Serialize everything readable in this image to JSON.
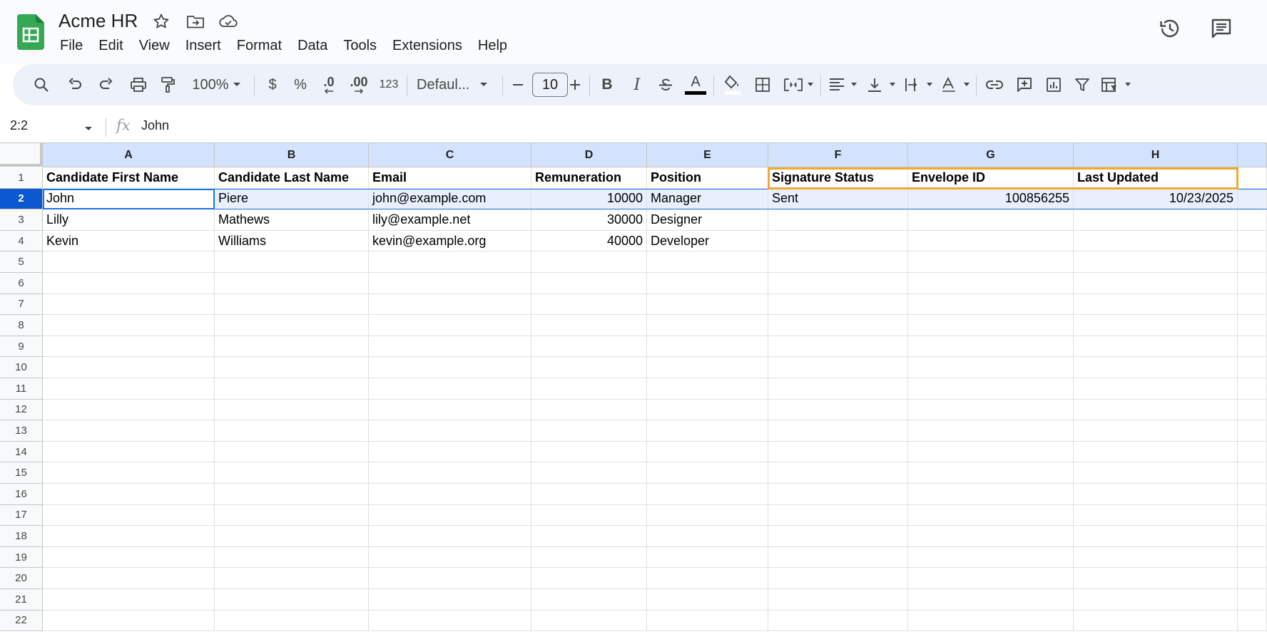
{
  "app": {
    "doc_title": "Acme HR",
    "menu": [
      "File",
      "Edit",
      "View",
      "Insert",
      "Format",
      "Data",
      "Tools",
      "Extensions",
      "Help"
    ]
  },
  "toolbar": {
    "zoom": "100%",
    "currency_label": "$",
    "percent_label": "%",
    "decrease_decimal_label": ".0",
    "increase_decimal_label": ".00",
    "number_format_label": "123",
    "font_family": "Defaul...",
    "font_size": "10",
    "bold_label": "B",
    "italic_label": "I",
    "text_color_label": "A",
    "text_color": "#000000"
  },
  "formula_bar": {
    "name_box": "2:2",
    "fx_label": "fx",
    "value": "John"
  },
  "sheet": {
    "columns": [
      "A",
      "B",
      "C",
      "D",
      "E",
      "F",
      "G",
      "H"
    ],
    "row_numbers": [
      "1",
      "2",
      "3",
      "4",
      "5",
      "6",
      "7",
      "8",
      "9",
      "10",
      "11",
      "12",
      "13",
      "14",
      "15",
      "16",
      "17",
      "18",
      "19",
      "20",
      "21",
      "22"
    ],
    "selected_row": "2",
    "rows": [
      [
        "Candidate First Name",
        "Candidate Last Name",
        "Email",
        "Remuneration",
        "Position",
        "Signature Status",
        "Envelope ID",
        "Last Updated"
      ],
      [
        "John",
        "Piere",
        "john@example.com",
        "10000",
        "Manager",
        "Sent",
        "100856255",
        "10/23/2025"
      ],
      [
        "Lilly",
        "Mathews",
        "lily@example.net",
        "30000",
        "Designer",
        "",
        "",
        ""
      ],
      [
        "Kevin",
        "Williams",
        "kevin@example.org",
        "40000",
        "Developer",
        "",
        "",
        ""
      ]
    ],
    "numeric_columns": [
      3,
      6,
      7
    ],
    "highlight_color": "#f0a830",
    "selection_color": "#1a73e8"
  }
}
